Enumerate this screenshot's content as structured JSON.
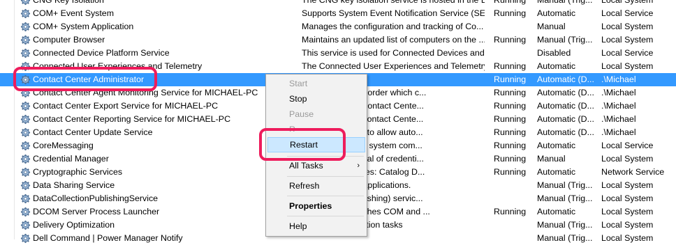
{
  "services": [
    {
      "name": "CNG Key Isolation",
      "description": "The CNG key isolation service is hosted in the L...",
      "status": "Running",
      "startup": "Manual (Trig...",
      "logon": "Local System",
      "selected": false
    },
    {
      "name": "COM+ Event System",
      "description": "Supports System Event Notification Service (SE...",
      "status": "Running",
      "startup": "Automatic",
      "logon": "Local Service",
      "selected": false
    },
    {
      "name": "COM+ System Application",
      "description": "Manages the configuration and tracking of Co...",
      "status": "",
      "startup": "Manual",
      "logon": "Local System",
      "selected": false
    },
    {
      "name": "Computer Browser",
      "description": "Maintains an updated list of computers on the ...",
      "status": "Running",
      "startup": "Manual (Trig...",
      "logon": "Local System",
      "selected": false
    },
    {
      "name": "Connected Device Platform Service",
      "description": "This service is used for Connected Devices and ...",
      "status": "",
      "startup": "Disabled",
      "logon": "Local Service",
      "selected": false
    },
    {
      "name": "Connected User Experiences and Telemetry",
      "description": "The Connected User Experiences and Telemetry ...",
      "status": "Running",
      "startup": "Automatic",
      "logon": "Local System",
      "selected": false
    },
    {
      "name": "Contact Center Administrator",
      "description": "",
      "status": "Running",
      "startup": "Automatic (D...",
      "logon": ".\\Michael",
      "selected": true
    },
    {
      "name": "Contact Center Agent Monitoring Service for MICHAEL-PC",
      "description": "service and a recorder which c...",
      "status": "Running",
      "startup": "Automatic (D...",
      "logon": ".\\Michael",
      "selected": false
    },
    {
      "name": "Contact Center Export Service for MICHAEL-PC",
      "description": "MyForce/Askia Contact Cente...",
      "status": "Running",
      "startup": "Automatic (D...",
      "logon": ".\\Michael",
      "selected": false
    },
    {
      "name": "Contact Center Reporting Service for MICHAEL-PC",
      "description": "for MI4C/Askia Contact Cente...",
      "status": "Running",
      "startup": "Automatic (D...",
      "logon": ".\\Michael",
      "selected": false
    },
    {
      "name": "Contact Center Update Service",
      "description": "elper application to allow auto...",
      "status": "Running",
      "startup": "Automatic (D...",
      "logon": ".\\Michael",
      "selected": false
    },
    {
      "name": "CoreMessaging",
      "description": "nication between system com...",
      "status": "Running",
      "startup": "Automatic",
      "logon": "Local Service",
      "selected": false
    },
    {
      "name": "Credential Manager",
      "description": "orage and retrieval of credenti...",
      "status": "Running",
      "startup": "Manual",
      "logon": "Local System",
      "selected": false
    },
    {
      "name": "Cryptographic Services",
      "description": "nagement services: Catalog D...",
      "status": "Running",
      "startup": "Automatic",
      "logon": "Network Service",
      "selected": false
    },
    {
      "name": "Data Sharing Service",
      "description": "kering between applications.",
      "status": "",
      "startup": "Manual (Trig...",
      "logon": "Local System",
      "selected": false
    },
    {
      "name": "DataCollectionPublishingService",
      "description": "llection and Publishing) servic...",
      "status": "",
      "startup": "Manual (Trig...",
      "logon": "Local System",
      "selected": false
    },
    {
      "name": "DCOM Server Process Launcher",
      "description": "CH service launches COM and ...",
      "status": "Running",
      "startup": "Automatic",
      "logon": "Local System",
      "selected": false
    },
    {
      "name": "Delivery Optimization",
      "description": "delivery optimization tasks",
      "status": "",
      "startup": "Manual (Trig...",
      "logon": "Local System",
      "selected": false
    },
    {
      "name": "Dell Command | Power Manager Notify",
      "description": "",
      "status": "",
      "startup": "Manual (Trig...",
      "logon": "Local System",
      "selected": false
    }
  ],
  "context_menu": {
    "items": [
      {
        "label": "Start",
        "enabled": false,
        "bold": false,
        "submenu": false,
        "hover": false
      },
      {
        "label": "Stop",
        "enabled": true,
        "bold": false,
        "submenu": false,
        "hover": false
      },
      {
        "label": "Pause",
        "enabled": false,
        "bold": false,
        "submenu": false,
        "hover": false
      },
      {
        "label": "R",
        "enabled": false,
        "bold": false,
        "submenu": false,
        "hover": false
      },
      {
        "label": "Restart",
        "enabled": true,
        "bold": false,
        "submenu": false,
        "hover": true
      },
      {
        "label": "All Tasks",
        "enabled": true,
        "bold": false,
        "submenu": true,
        "hover": false
      },
      {
        "label": "Refresh",
        "enabled": true,
        "bold": false,
        "submenu": false,
        "hover": false
      },
      {
        "label": "Properties",
        "enabled": true,
        "bold": true,
        "submenu": false,
        "hover": false
      },
      {
        "label": "Help",
        "enabled": true,
        "bold": false,
        "submenu": false,
        "hover": false
      }
    ],
    "submenu_arrow": "›"
  },
  "icon_name": "gear-icon",
  "colors": {
    "selection": "#3399ff",
    "highlight": "#ee1c5c",
    "menu_hover": "#cce8ff"
  }
}
